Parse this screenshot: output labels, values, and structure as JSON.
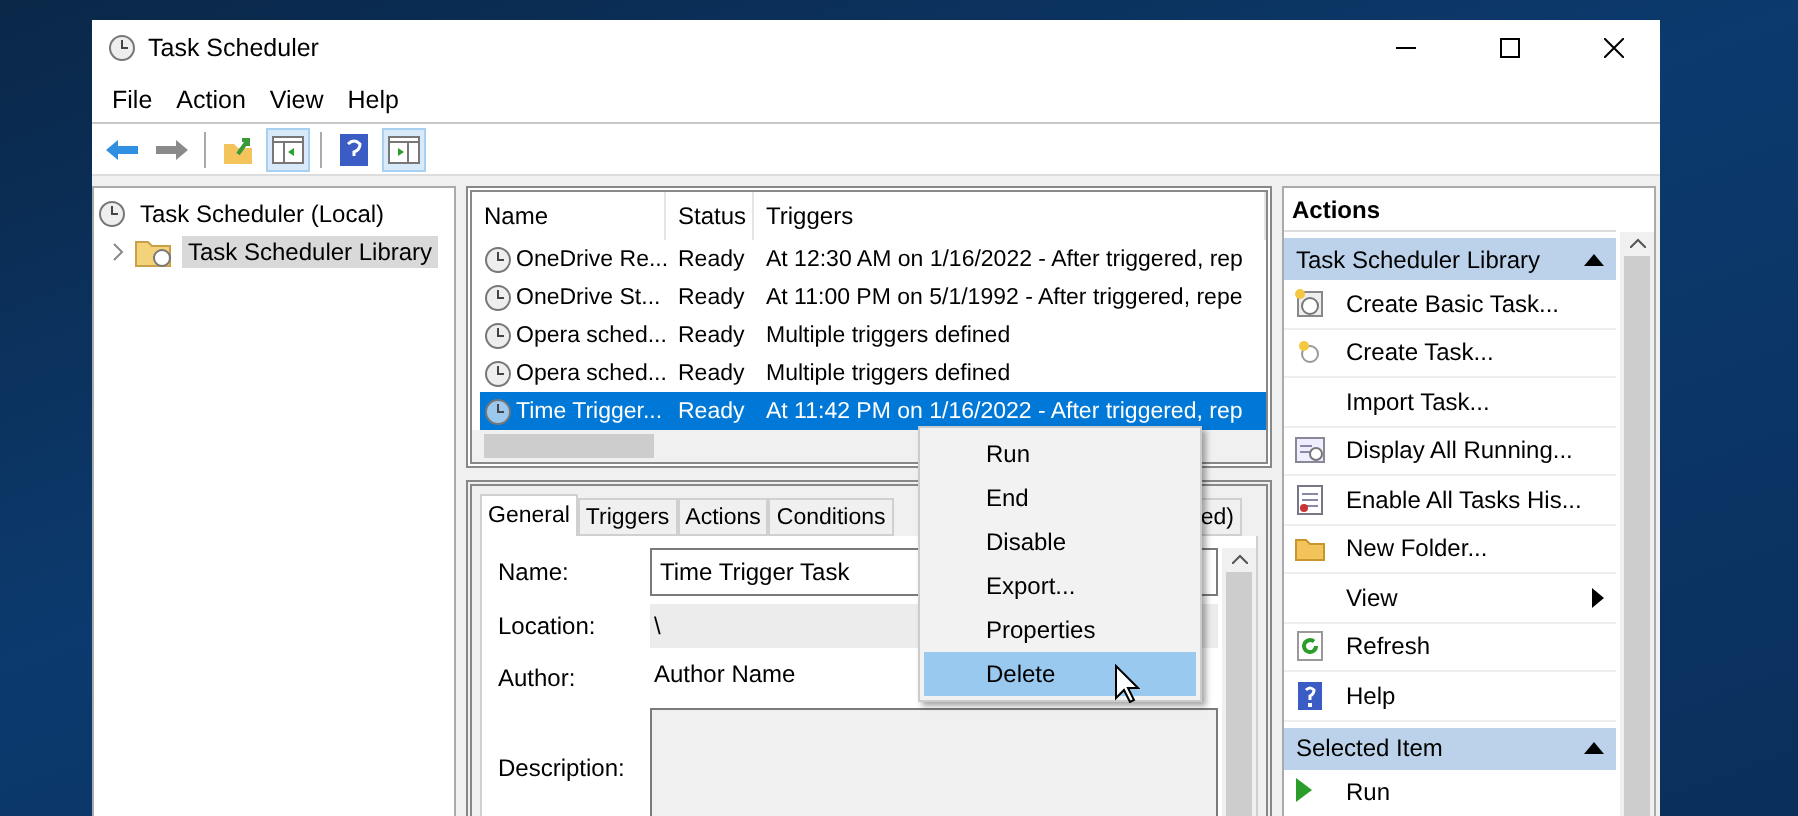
{
  "window": {
    "title": "Task Scheduler"
  },
  "menu": [
    "File",
    "Action",
    "View",
    "Help"
  ],
  "tree": [
    {
      "label": "Task Scheduler (Local)",
      "selected": false,
      "children": [
        {
          "label": "Task Scheduler Library",
          "selected": true,
          "expanded": false
        }
      ]
    }
  ],
  "tasks": {
    "columns": [
      "Name",
      "Status",
      "Triggers"
    ],
    "rows": [
      {
        "name": "OneDrive Re...",
        "status": "Ready",
        "triggers": "At 12:30 AM on 1/16/2022 - After triggered, rep",
        "selected": false
      },
      {
        "name": "OneDrive St...",
        "status": "Ready",
        "triggers": "At 11:00 PM on 5/1/1992 - After triggered, repe",
        "selected": false
      },
      {
        "name": "Opera sched...",
        "status": "Ready",
        "triggers": "Multiple triggers defined",
        "selected": false
      },
      {
        "name": "Opera sched...",
        "status": "Ready",
        "triggers": "Multiple triggers defined",
        "selected": false
      },
      {
        "name": "Time Trigger...",
        "status": "Ready",
        "triggers": "At 11:42 PM on 1/16/2022 - After triggered, rep",
        "selected": true
      }
    ]
  },
  "details": {
    "tabs": [
      {
        "label": "General",
        "selected": true
      },
      {
        "label": "Triggers",
        "selected": false
      },
      {
        "label": "Actions",
        "selected": false
      },
      {
        "label": "Conditions",
        "selected": false
      },
      {
        "label": "ed)",
        "selected": false
      }
    ],
    "fields": [
      {
        "kind": "input",
        "label": "Name:",
        "value": "Time Trigger Task"
      },
      {
        "kind": "readonly",
        "label": "Location:",
        "value": "\\"
      },
      {
        "kind": "text",
        "label": "Author:",
        "value": "Author Name"
      },
      {
        "kind": "textarea",
        "label": "Description:"
      }
    ]
  },
  "context_menu": [
    {
      "label": "Run",
      "selected": false
    },
    {
      "label": "End",
      "selected": false
    },
    {
      "label": "Disable",
      "selected": false
    },
    {
      "label": "Export...",
      "selected": false
    },
    {
      "label": "Properties",
      "selected": false
    },
    {
      "label": "Delete",
      "selected": true
    }
  ],
  "actions": {
    "title": "Actions",
    "sections": [
      {
        "title": "Task Scheduler Library",
        "expanded": true,
        "items": [
          {
            "label": "Create Basic Task...",
            "submenu": false
          },
          {
            "label": "Create Task...",
            "submenu": false
          },
          {
            "label": "Import Task...",
            "submenu": false
          },
          {
            "label": "Display All Running...",
            "submenu": false
          },
          {
            "label": "Enable All Tasks His...",
            "submenu": false
          },
          {
            "label": "New Folder...",
            "submenu": false
          },
          {
            "label": "View",
            "submenu": true
          },
          {
            "label": "Refresh",
            "submenu": false
          },
          {
            "label": "Help",
            "submenu": false
          }
        ]
      },
      {
        "title": "Selected Item",
        "expanded": true,
        "items": [
          {
            "label": "Run",
            "submenu": false
          }
        ]
      }
    ]
  }
}
